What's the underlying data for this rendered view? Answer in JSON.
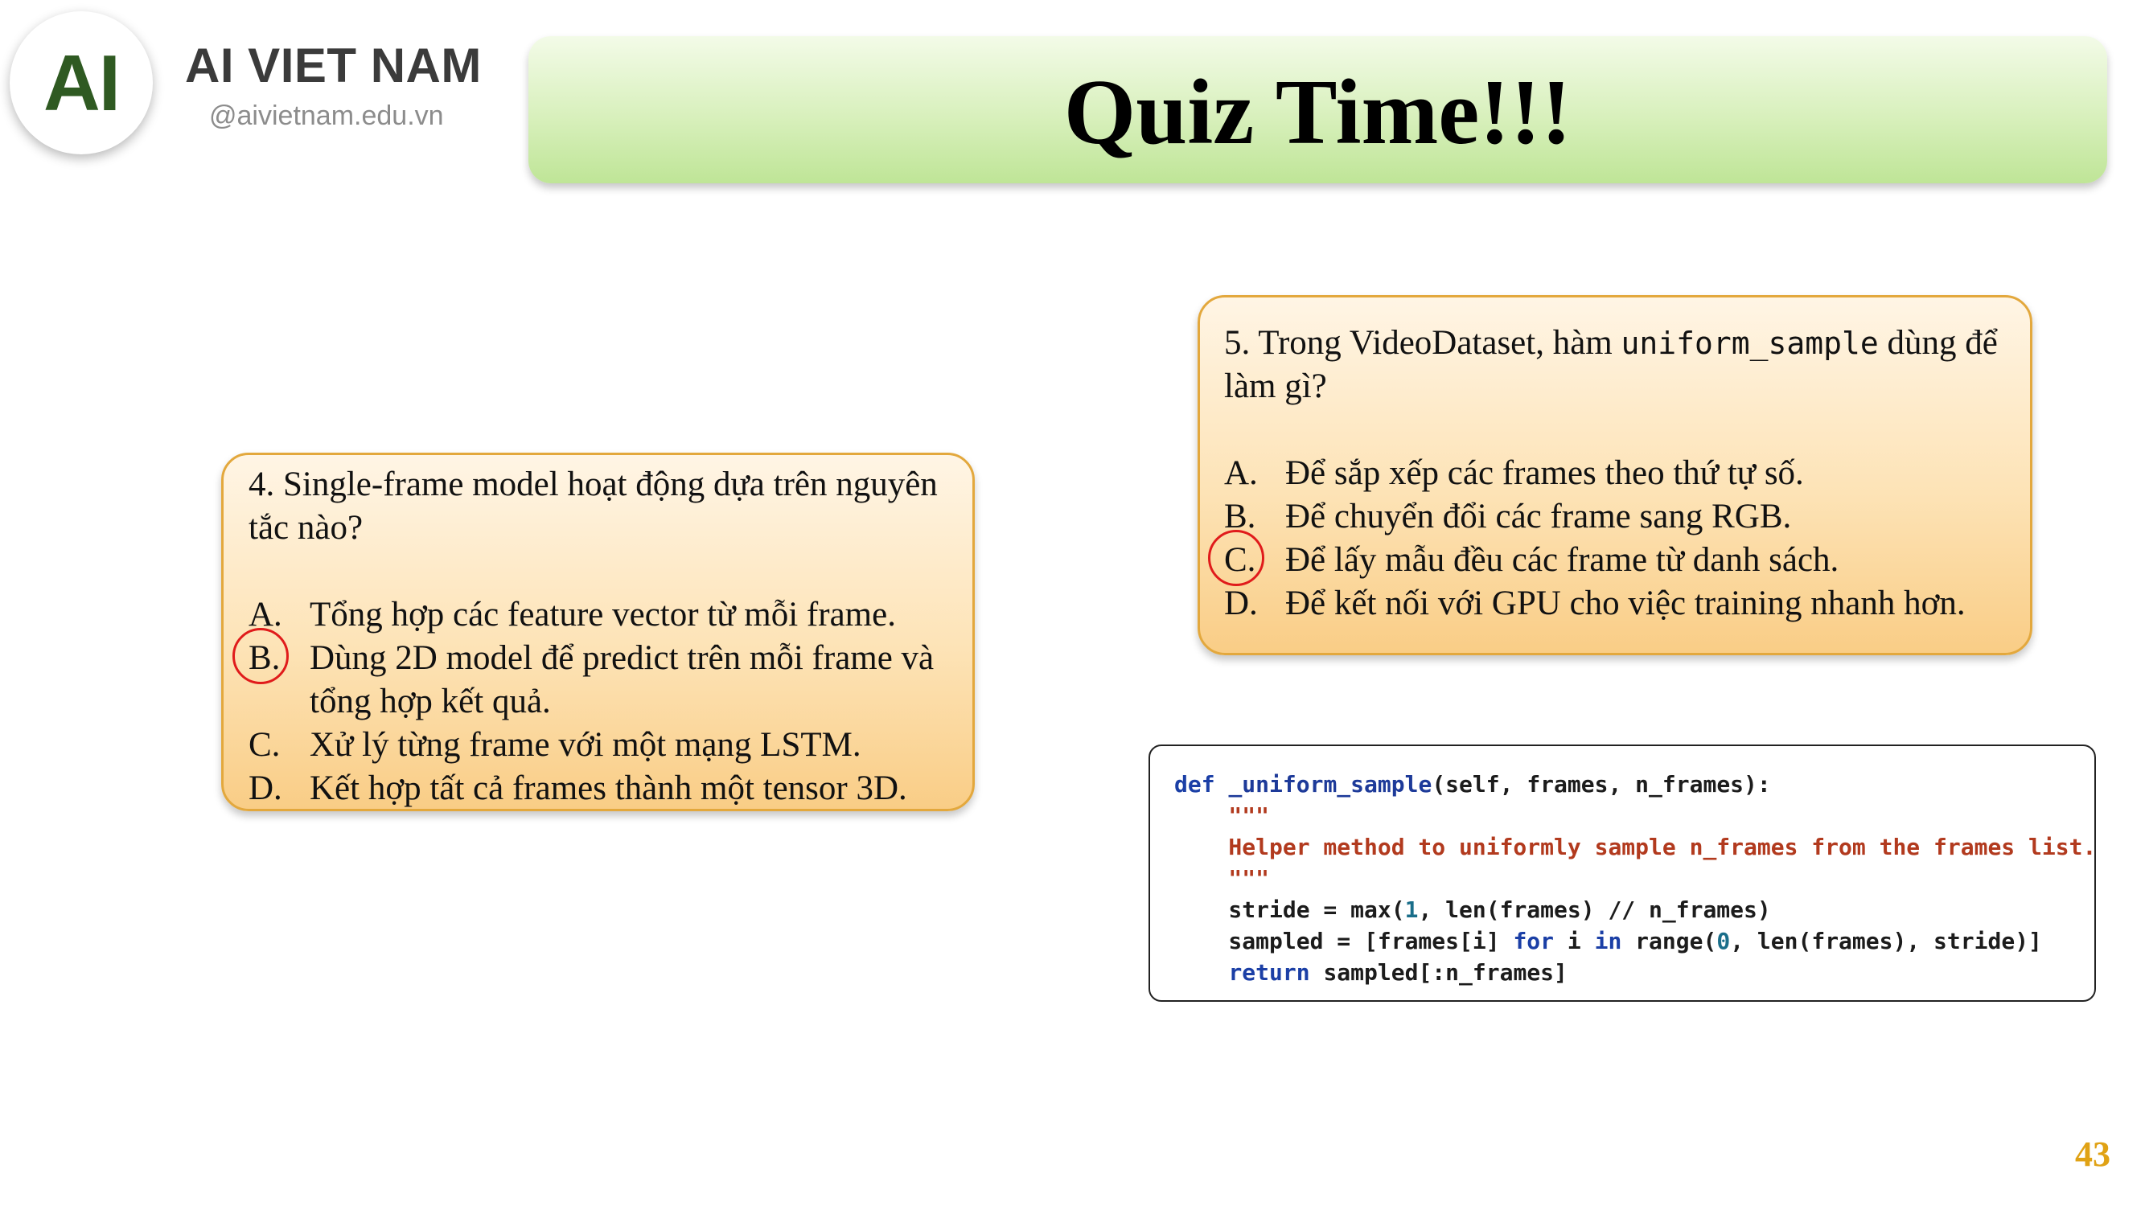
{
  "header": {
    "logo_mark": "AI",
    "brand_name": "AI VIET NAM",
    "brand_site": "@aivietnam.edu.vn",
    "title": "Quiz Time!!!"
  },
  "quiz4": {
    "question": "4. Single-frame model hoạt động dựa trên nguyên tắc nào?",
    "options": [
      {
        "letter": "A.",
        "text": "Tổng hợp các feature vector từ mỗi frame."
      },
      {
        "letter": "B.",
        "text": "Dùng 2D model để predict trên mỗi frame và tổng hợp kết quả."
      },
      {
        "letter": "C.",
        "text": "Xử lý từng frame với một mạng LSTM."
      },
      {
        "letter": "D.",
        "text": "Kết hợp tất cả frames thành một tensor 3D."
      }
    ],
    "selected": "B."
  },
  "quiz5": {
    "question_prefix": "5. Trong VideoDataset, hàm ",
    "question_code": "uniform_sample",
    "question_suffix": " dùng để làm gì?",
    "options": [
      {
        "letter": "A.",
        "text": "Để sắp xếp các frames theo thứ tự số."
      },
      {
        "letter": "B.",
        "text": "Để chuyển đổi các frame sang RGB."
      },
      {
        "letter": "C.",
        "text": "Để lấy mẫu đều các frame từ danh sách."
      },
      {
        "letter": "D.",
        "text": "Để kết nối với GPU cho việc training nhanh hơn."
      }
    ],
    "selected": "C."
  },
  "code": {
    "l1_def": "def",
    "l1_name": "_uniform_sample",
    "l1_rest": "(self, frames, n_frames):",
    "l2_doc_open": "    \"\"\"",
    "l3_doc": "    Helper method to uniformly sample n_frames from the frames list.",
    "l4_doc_close": "    \"\"\"",
    "l5_a": "    stride = max(",
    "l5_num": "1",
    "l5_b": ", len(frames) // n_frames)",
    "l6_a": "    sampled = [frames[i] ",
    "l6_for": "for",
    "l6_b": " i ",
    "l6_in": "in",
    "l6_c": " range(",
    "l6_num": "0",
    "l6_d": ", len(frames), stride)]",
    "l7_indent": "    ",
    "l7_return": "return",
    "l7_rest": " sampled[:n_frames]"
  },
  "page_number": "43",
  "colors": {
    "logo_green": "#2f5a22",
    "title_banner_green": "#d8f0bc",
    "quiz_box_orange": "#fde3b6",
    "quiz_border": "#e3a83d",
    "answer_ring_red": "#e01b1b",
    "page_number_gold": "#e0a215"
  }
}
